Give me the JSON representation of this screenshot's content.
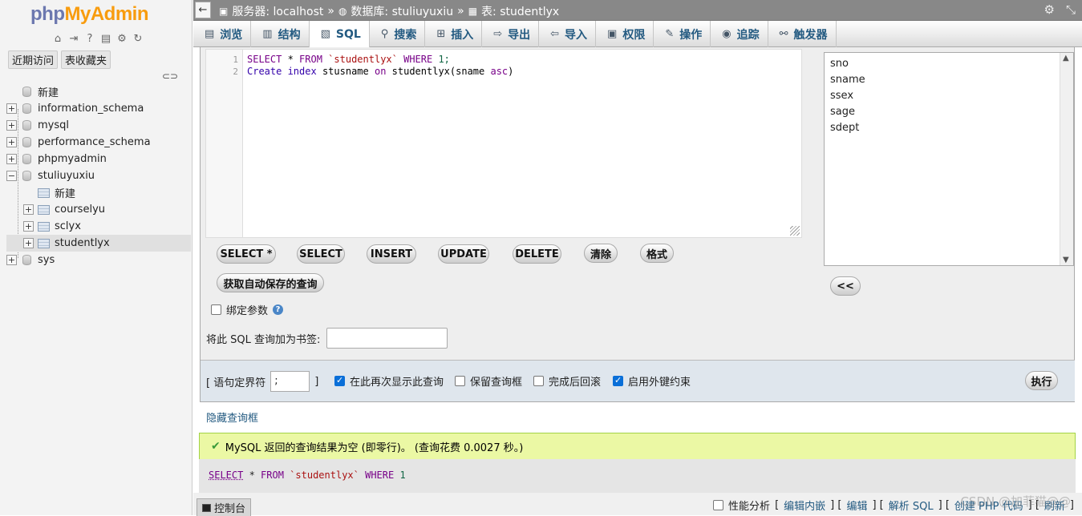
{
  "app": {
    "logo_php": "php",
    "logo_myadmin": "MyAdmin",
    "brand_colors": {
      "php": "#6c78af",
      "myadmin": "#f89c0e"
    }
  },
  "left_tabs": [
    "近期访问",
    "表收藏夹"
  ],
  "tree": {
    "new_label": "新建",
    "databases": [
      "information_schema",
      "mysql",
      "performance_schema",
      "phpmyadmin",
      "stuliuyuxiu",
      "sys"
    ],
    "expanded_db": {
      "new_label": "新建",
      "tables": [
        "courselyu",
        "sclyx",
        "studentlyx"
      ]
    }
  },
  "breadcrumb": {
    "server": "服务器: localhost",
    "database": "数据库: stuliuyuxiu",
    "table": "表: studentlyx",
    "sep": "»"
  },
  "tabs": [
    {
      "label": "浏览",
      "icon": "browse-icon"
    },
    {
      "label": "结构",
      "icon": "structure-icon"
    },
    {
      "label": "SQL",
      "icon": "sql-icon"
    },
    {
      "label": "搜索",
      "icon": "search-icon"
    },
    {
      "label": "插入",
      "icon": "insert-icon"
    },
    {
      "label": "导出",
      "icon": "export-icon"
    },
    {
      "label": "导入",
      "icon": "import-icon"
    },
    {
      "label": "权限",
      "icon": "privileges-icon"
    },
    {
      "label": "操作",
      "icon": "operations-icon"
    },
    {
      "label": "追踪",
      "icon": "tracking-icon"
    },
    {
      "label": "触发器",
      "icon": "triggers-icon"
    }
  ],
  "editor": {
    "line_numbers": [
      "1",
      "2"
    ],
    "line1": {
      "kw1": "SELECT",
      "star": " * ",
      "kw2": "FROM",
      "tbl": " `studentlyx` ",
      "kw3": "WHERE",
      "num": " 1;"
    },
    "line2": {
      "kw1": "Create",
      "kw2": " index",
      "name": " stusname ",
      "kw3": "on",
      "rest": " studentlyx(sname ",
      "kw4": "asc",
      "close": ")"
    }
  },
  "query_buttons": [
    "SELECT *",
    "SELECT",
    "INSERT",
    "UPDATE",
    "DELETE",
    "清除",
    "格式"
  ],
  "autosave_button": "获取自动保存的查询",
  "columns": [
    "sno",
    "sname",
    "ssex",
    "sage",
    "sdept"
  ],
  "insert_column_button": "<<",
  "bind_params_label": "绑定参数",
  "bookmark_label": "将此 SQL 查询加为书签:",
  "options": {
    "delimiter_open": "[ 语句定界符",
    "delimiter_value": ";",
    "delimiter_close": "]",
    "show_again": "在此再次显示此查询",
    "retain_box": "保留查询框",
    "rollback": "完成后回滚",
    "fk_checks": "启用外键约束",
    "go_button": "执行"
  },
  "hide_query_box": "隐藏查询框",
  "result_message": "MySQL 返回的查询结果为空 (即零行)。 (查询花费 0.0027 秒。)",
  "executed_sql": {
    "kw1": "SELECT",
    "rest1": " * ",
    "kw2": "FROM",
    "tbl": " `studentlyx` ",
    "kw3": "WHERE",
    "num": " 1"
  },
  "bottom": {
    "console": "控制台",
    "profiling": "性能分析",
    "edit_inline": "编辑内嵌",
    "edit": "编辑",
    "explain": "解析 SQL",
    "create_php": "创建 PHP 代码",
    "refresh": "刷新",
    "lb": "[",
    "rb": "]",
    "sep": "] ["
  },
  "watermark": "CSDN @加菲猫@@"
}
